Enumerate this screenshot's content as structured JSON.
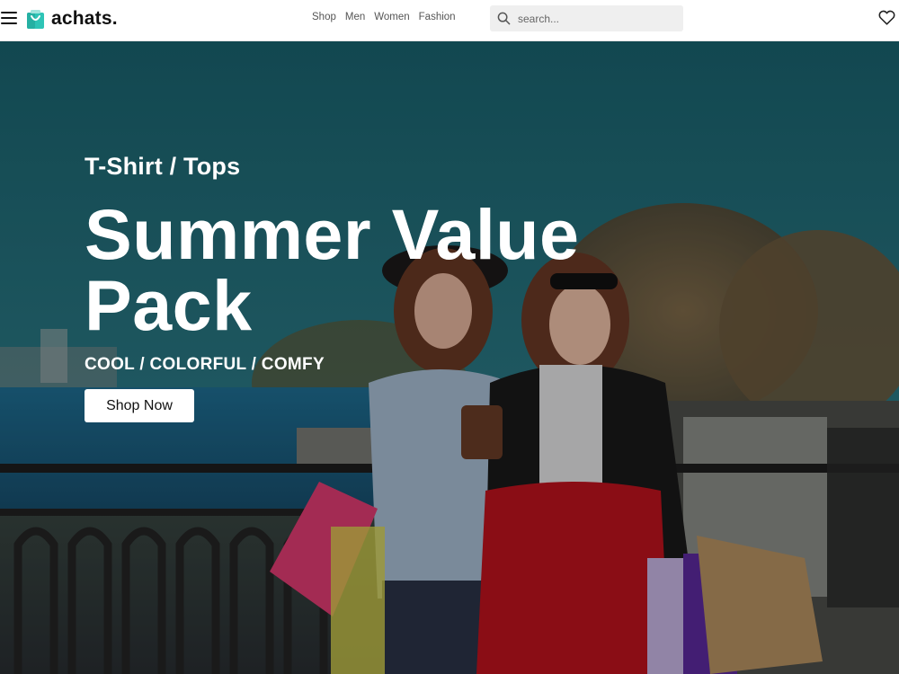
{
  "header": {
    "brand": "achats.",
    "nav": [
      "Shop",
      "Men",
      "Women",
      "Fashion"
    ],
    "search_placeholder": "search..."
  },
  "icons": {
    "menu": "hamburger-menu-icon",
    "logo": "shopping-bag-logo-icon",
    "search": "search-icon",
    "wishlist": "heart-icon"
  },
  "colors": {
    "logo_accent": "#2ec4b6",
    "hero_button_bg": "#ffffff",
    "hero_text": "#ffffff"
  },
  "hero": {
    "subtitle": "T-Shirt / Tops",
    "headline": "Summer Value Pack",
    "tagline": "COOL / COLORFUL / COMFY",
    "cta_label": "Shop Now"
  }
}
